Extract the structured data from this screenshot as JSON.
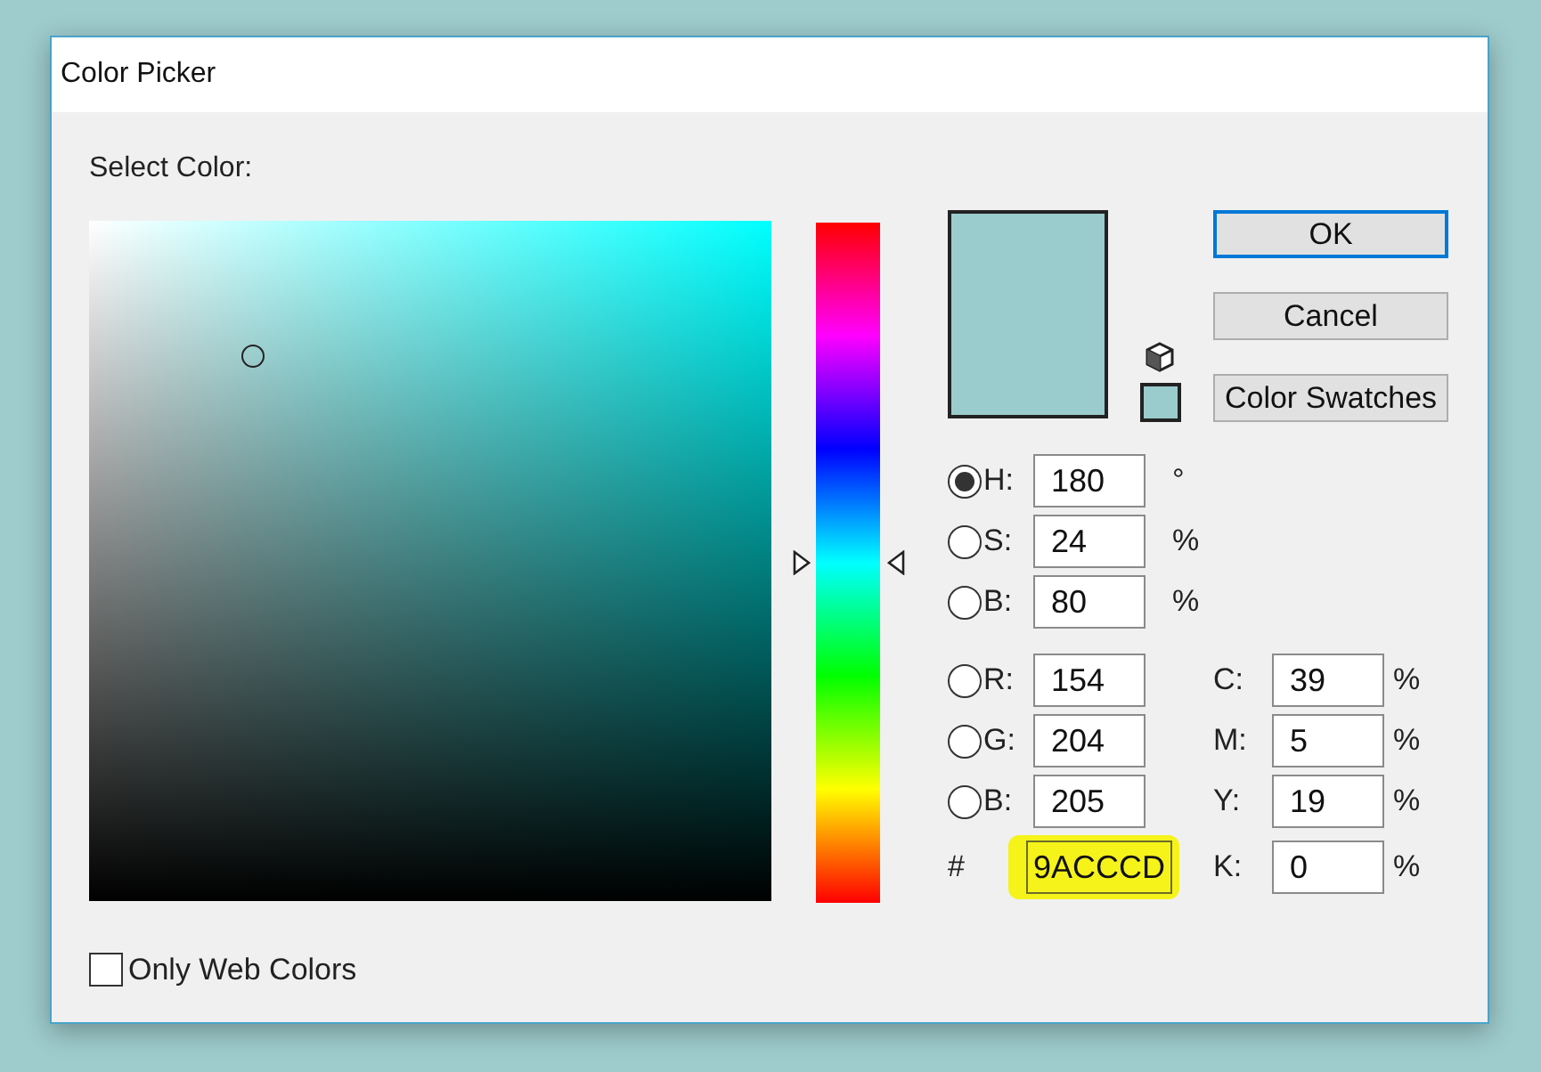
{
  "window": {
    "title": "Color Picker"
  },
  "select_label": "Select Color:",
  "hue_slider": {
    "level": 0.5
  },
  "buttons": [
    {
      "label": "OK",
      "default": true
    },
    {
      "label": "Cancel",
      "default": false
    },
    {
      "label": "Color Swatches",
      "default": false
    }
  ],
  "hsb": [
    {
      "label": "H:",
      "value": "180",
      "unit": "°",
      "selected": true
    },
    {
      "label": "S:",
      "value": "24",
      "unit": "%",
      "selected": false
    },
    {
      "label": "B:",
      "value": "80",
      "unit": "%",
      "selected": false
    }
  ],
  "rgb": [
    {
      "label": "R:",
      "value": "154",
      "selected": false
    },
    {
      "label": "G:",
      "value": "204",
      "selected": false
    },
    {
      "label": "B:",
      "value": "205",
      "selected": false
    }
  ],
  "hex": {
    "label": "#",
    "value": "9ACCCD",
    "highlighted": true
  },
  "cmyk": [
    {
      "label": "C:",
      "value": "39",
      "unit": "%"
    },
    {
      "label": "M:",
      "value": "5",
      "unit": "%"
    },
    {
      "label": "Y:",
      "value": "19",
      "unit": "%"
    },
    {
      "label": "K:",
      "value": "0",
      "unit": "%"
    }
  ],
  "only_web_colors": {
    "label": "Only Web Colors",
    "checked": false
  }
}
